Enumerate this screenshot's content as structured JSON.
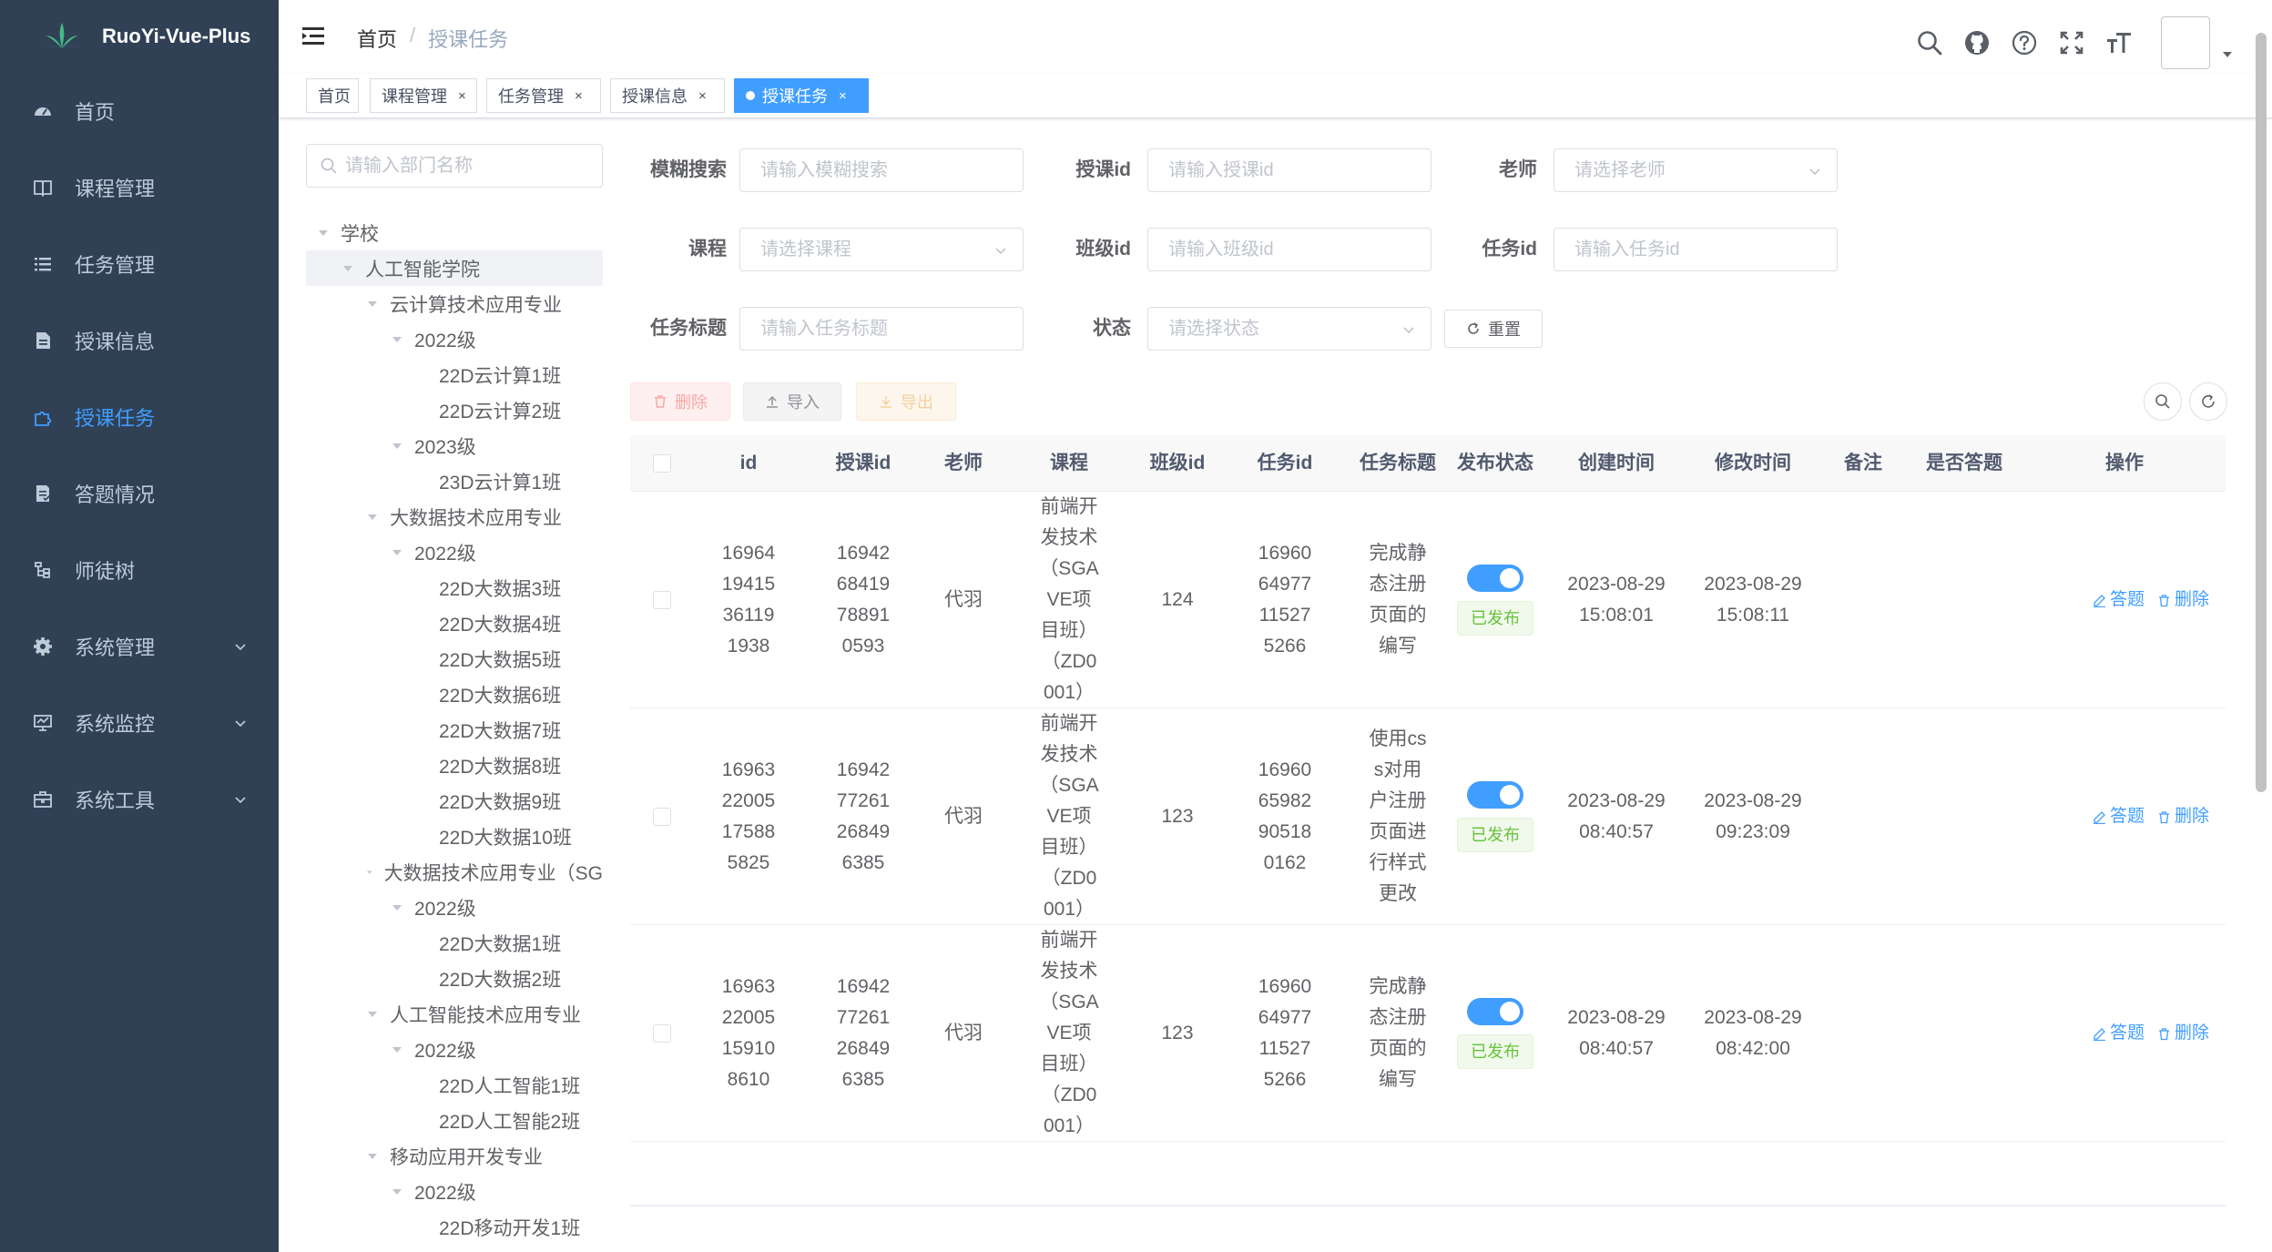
{
  "app": {
    "title": "RuoYi-Vue-Plus"
  },
  "sidebar": {
    "items": [
      {
        "label": "首页",
        "icon": "dashboard-icon"
      },
      {
        "label": "课程管理",
        "icon": "book-icon"
      },
      {
        "label": "任务管理",
        "icon": "list-icon"
      },
      {
        "label": "授课信息",
        "icon": "document-icon"
      },
      {
        "label": "授课任务",
        "icon": "puzzle-icon",
        "active": true
      },
      {
        "label": "答题情况",
        "icon": "answer-doc-icon"
      },
      {
        "label": "师徒树",
        "icon": "tree-icon"
      },
      {
        "label": "系统管理",
        "icon": "gear-icon",
        "expandable": true
      },
      {
        "label": "系统监控",
        "icon": "monitor-icon",
        "expandable": true
      },
      {
        "label": "系统工具",
        "icon": "toolbox-icon",
        "expandable": true
      }
    ]
  },
  "header": {
    "breadcrumb": {
      "home": "首页",
      "separator": "/",
      "current": "授课任务"
    },
    "icons": [
      "search-icon",
      "github-icon",
      "question-icon",
      "fullscreen-icon",
      "font-size-icon"
    ]
  },
  "tags": [
    {
      "label": "首页",
      "closable": false
    },
    {
      "label": "课程管理",
      "closable": true,
      "close": "×"
    },
    {
      "label": "任务管理",
      "closable": true,
      "close": "×"
    },
    {
      "label": "授课信息",
      "closable": true,
      "close": "×"
    },
    {
      "label": "授课任务",
      "closable": true,
      "close": "×",
      "active": true
    }
  ],
  "tree": {
    "search_placeholder": "请输入部门名称",
    "nodes": [
      {
        "label": "学校",
        "level": 0,
        "expanded": true
      },
      {
        "label": "人工智能学院",
        "level": 1,
        "expanded": true,
        "selected": true
      },
      {
        "label": "云计算技术应用专业",
        "level": 2,
        "expanded": true
      },
      {
        "label": "2022级",
        "level": 3,
        "expanded": true
      },
      {
        "label": "22D云计算1班",
        "level": 4,
        "leaf": true
      },
      {
        "label": "22D云计算2班",
        "level": 4,
        "leaf": true
      },
      {
        "label": "2023级",
        "level": 3,
        "expanded": true
      },
      {
        "label": "23D云计算1班",
        "level": 4,
        "leaf": true
      },
      {
        "label": "大数据技术应用专业",
        "level": 2,
        "expanded": true
      },
      {
        "label": "2022级",
        "level": 3,
        "expanded": true
      },
      {
        "label": "22D大数据3班",
        "level": 4,
        "leaf": true
      },
      {
        "label": "22D大数据4班",
        "level": 4,
        "leaf": true
      },
      {
        "label": "22D大数据5班",
        "level": 4,
        "leaf": true
      },
      {
        "label": "22D大数据6班",
        "level": 4,
        "leaf": true
      },
      {
        "label": "22D大数据7班",
        "level": 4,
        "leaf": true
      },
      {
        "label": "22D大数据8班",
        "level": 4,
        "leaf": true
      },
      {
        "label": "22D大数据9班",
        "level": 4,
        "leaf": true
      },
      {
        "label": "22D大数据10班",
        "level": 4,
        "leaf": true
      },
      {
        "label": "大数据技术应用专业（SG",
        "level": 2,
        "expanded": true
      },
      {
        "label": "2022级",
        "level": 3,
        "expanded": true
      },
      {
        "label": "22D大数据1班",
        "level": 4,
        "leaf": true
      },
      {
        "label": "22D大数据2班",
        "level": 4,
        "leaf": true
      },
      {
        "label": "人工智能技术应用专业",
        "level": 2,
        "expanded": true
      },
      {
        "label": "2022级",
        "level": 3,
        "expanded": true
      },
      {
        "label": "22D人工智能1班",
        "level": 4,
        "leaf": true
      },
      {
        "label": "22D人工智能2班",
        "level": 4,
        "leaf": true
      },
      {
        "label": "移动应用开发专业",
        "level": 2,
        "expanded": true
      },
      {
        "label": "2022级",
        "level": 3,
        "expanded": true
      },
      {
        "label": "22D移动开发1班",
        "level": 4,
        "leaf": true
      }
    ]
  },
  "search": {
    "fuzzy": {
      "label": "模糊搜索",
      "placeholder": "请输入模糊搜索"
    },
    "teaching_id": {
      "label": "授课id",
      "placeholder": "请输入授课id"
    },
    "teacher": {
      "label": "老师",
      "placeholder": "请选择老师"
    },
    "course": {
      "label": "课程",
      "placeholder": "请选择课程"
    },
    "class_id": {
      "label": "班级id",
      "placeholder": "请输入班级id"
    },
    "task_id": {
      "label": "任务id",
      "placeholder": "请输入任务id"
    },
    "task_title": {
      "label": "任务标题",
      "placeholder": "请输入任务标题"
    },
    "status": {
      "label": "状态",
      "placeholder": "请选择状态"
    },
    "reset_label": "重置"
  },
  "toolbar": {
    "delete_label": "删除",
    "import_label": "导入",
    "export_label": "导出"
  },
  "table": {
    "columns": [
      "id",
      "授课id",
      "老师",
      "课程",
      "班级id",
      "任务id",
      "任务标题",
      "发布状态",
      "创建时间",
      "修改时间",
      "备注",
      "是否答题",
      "操作"
    ],
    "rows": [
      {
        "id": "1696419415361191938",
        "teaching_id": "1694268419788910593",
        "teacher": "代羽",
        "course": "前端开发技术（SGAVE项目班）（ZD0001）",
        "class_id": "124",
        "task_id": "1696064977115275266",
        "task_title": "完成静态注册页面的编写",
        "status": "已发布",
        "created": "2023-08-29 15:08:01",
        "modified": "2023-08-29 15:08:11",
        "remark": "",
        "answered": "",
        "op_answer": "答题",
        "op_delete": "删除"
      },
      {
        "id": "1696322005175885825",
        "teaching_id": "1694277261268496385",
        "teacher": "代羽",
        "course": "前端开发技术（SGAVE项目班）（ZD0001）",
        "class_id": "123",
        "task_id": "1696065982905180162",
        "task_title": "使用css对用户注册页面进行样式更改",
        "status": "已发布",
        "created": "2023-08-29 08:40:57",
        "modified": "2023-08-29 09:23:09",
        "remark": "",
        "answered": "",
        "op_answer": "答题",
        "op_delete": "删除"
      },
      {
        "id": "1696322005159108610",
        "teaching_id": "1694277261268496385",
        "teacher": "代羽",
        "course": "前端开发技术（SGAVE项目班）（ZD0001）",
        "class_id": "123",
        "task_id": "1696064977115275266",
        "task_title": "完成静态注册页面的编写",
        "status": "已发布",
        "created": "2023-08-29 08:40:57",
        "modified": "2023-08-29 08:42:00",
        "remark": "",
        "answered": "",
        "op_answer": "答题",
        "op_delete": "删除"
      }
    ]
  },
  "colors": {
    "sidebar_bg": "#304156",
    "accent": "#409eff",
    "success": "#67c23a",
    "danger": "#f56c6c",
    "warning": "#e6a23c"
  }
}
